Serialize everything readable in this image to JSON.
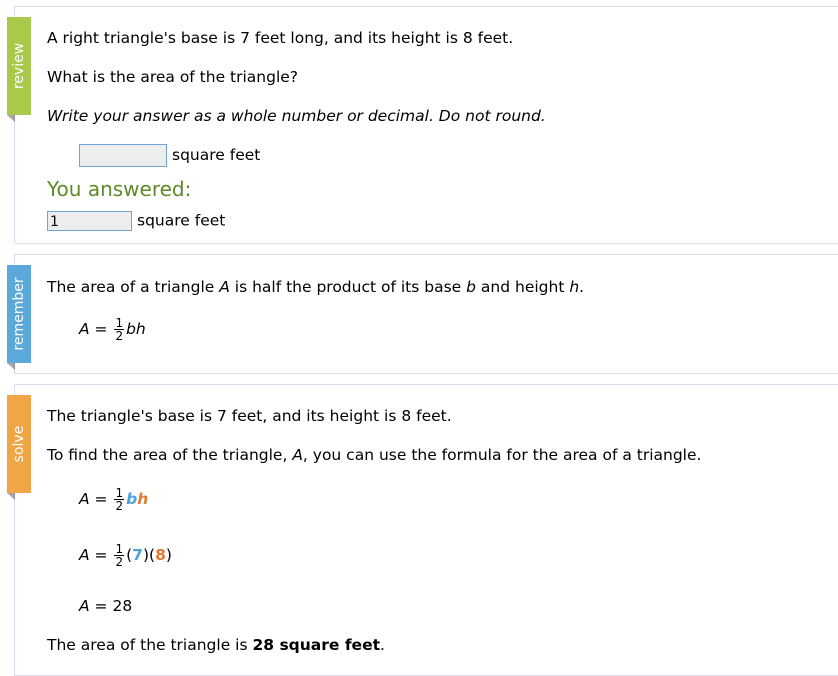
{
  "review": {
    "tab": "review",
    "q1": "A right triangle's base is 7 feet long, and its height is 8 feet.",
    "q2": "What is the area of the triangle?",
    "instr": "Write your answer as a whole number or decimal. Do not round.",
    "input_value": "",
    "unit": "square feet",
    "you_answered": "You answered:",
    "answer": "1",
    "answer_unit": "square feet"
  },
  "remember": {
    "tab": "remember",
    "text_pre": "The area of a triangle ",
    "A": "A",
    "text_mid": " is half the product of its base ",
    "b": "b",
    "text_mid2": " and height ",
    "h": "h",
    "text_end": ".",
    "formula": {
      "lhs": "A",
      "eq": " = ",
      "num": "1",
      "den": "2",
      "rest": "bh"
    }
  },
  "solve": {
    "tab": "solve",
    "s1": "The triangle's base is 7 feet, and its height is 8 feet.",
    "s2_pre": "To find the area of the triangle, ",
    "s2_A": "A",
    "s2_post": ", you can use the formula for the area of a triangle.",
    "f1": {
      "lhs": "A",
      "eq": " = ",
      "num": "1",
      "den": "2",
      "b": "b",
      "h": "h"
    },
    "f2": {
      "lhs": "A",
      "eq": " = ",
      "num": "1",
      "den": "2",
      "open1": "(",
      "b": "7",
      "close1": ")(",
      "h": "8",
      "close2": ")"
    },
    "f3": {
      "lhs": "A",
      "eq": " = ",
      "val": "28"
    },
    "final_pre": "The area of the triangle is ",
    "final_bold": "28 square feet",
    "final_end": "."
  },
  "colors": {
    "review": "#a8c94a",
    "remember": "#5aa9d8",
    "solve": "#f0a646"
  }
}
